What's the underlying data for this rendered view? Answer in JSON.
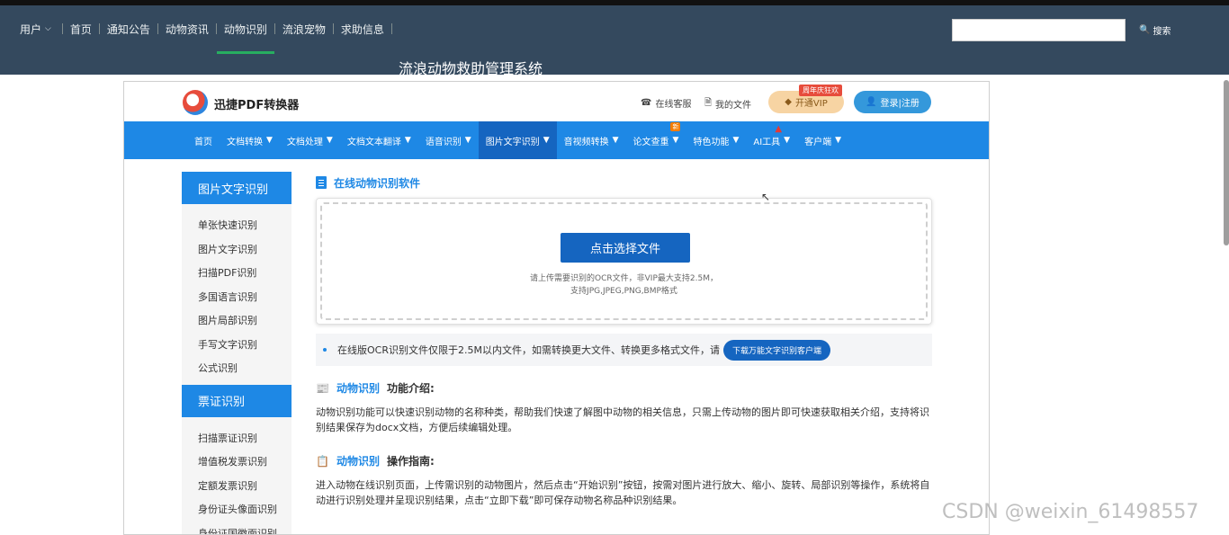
{
  "header": {
    "user_label": "用户",
    "nav": [
      "首页",
      "通知公告",
      "动物资讯",
      "动物识别",
      "流浪宠物",
      "求助信息"
    ],
    "active_index": 3,
    "search_placeholder": "",
    "search_label": "搜索",
    "site_title": "流浪动物救助管理系统"
  },
  "frame": {
    "brand": "迅捷PDF转换器",
    "links": {
      "service": "在线客服",
      "files": "我的文件"
    },
    "vip": {
      "label": "开通VIP",
      "ribbon": "周年庆狂欢"
    },
    "login_label": "登录|注册",
    "menu": [
      "首页",
      "文档转换",
      "文档处理",
      "文档文本翻译",
      "语音识别",
      "图片文字识别",
      "音视频转换",
      "论文查重",
      "特色功能",
      "AI工具",
      "客户端"
    ],
    "menu_active_index": 5,
    "new_badge": "新"
  },
  "sidebar": {
    "sections": [
      {
        "title": "图片文字识别",
        "items": [
          "单张快速识别",
          "图片文字识别",
          "扫描PDF识别",
          "多国语言识别",
          "图片局部识别",
          "手写文字识别",
          "公式识别"
        ]
      },
      {
        "title": "票证识别",
        "items": [
          "扫描票证识别",
          "增值税发票识别",
          "定额发票识别",
          "身份证头像面识别",
          "身份证国徽面识别"
        ]
      }
    ]
  },
  "content": {
    "section_title": "在线动物识别软件",
    "upload_button": "点击选择文件",
    "upload_hint_line1": "请上传需要识别的OCR文件，非VIP最大支持2.5M，",
    "upload_hint_line2": "支持JPG,JPEG,PNG,BMP格式",
    "notice_text": "在线版OCR识别文件仅限于2.5M以内文件，如需转换更大文件、转换更多格式文件，请",
    "notice_button": "下载万能文字识别客户端",
    "feature_title_main": "动物识别",
    "feature_title_sub": "功能介绍:",
    "feature_text": "动物识别功能可以快速识别动物的名称种类，帮助我们快速了解图中动物的相关信息，只需上传动物的图片即可快速获取相关介绍，支持将识别结果保存为docx文档，方便后续编辑处理。",
    "guide_title_main": "动物识别",
    "guide_title_sub": "操作指南:",
    "guide_text": "进入动物在线识别页面，上传需识别的动物图片，然后点击“开始识别”按钮，按需对图片进行放大、缩小、旋转、局部识别等操作，系统将自动进行识别处理并呈现识别结果，点击“立即下载”即可保存动物名称品种识别结果。"
  },
  "watermark": "CSDN @weixin_61498557",
  "colors": {
    "header_bg": "#34495e",
    "primary": "#1e88e5",
    "active_underline": "#27ae60"
  }
}
